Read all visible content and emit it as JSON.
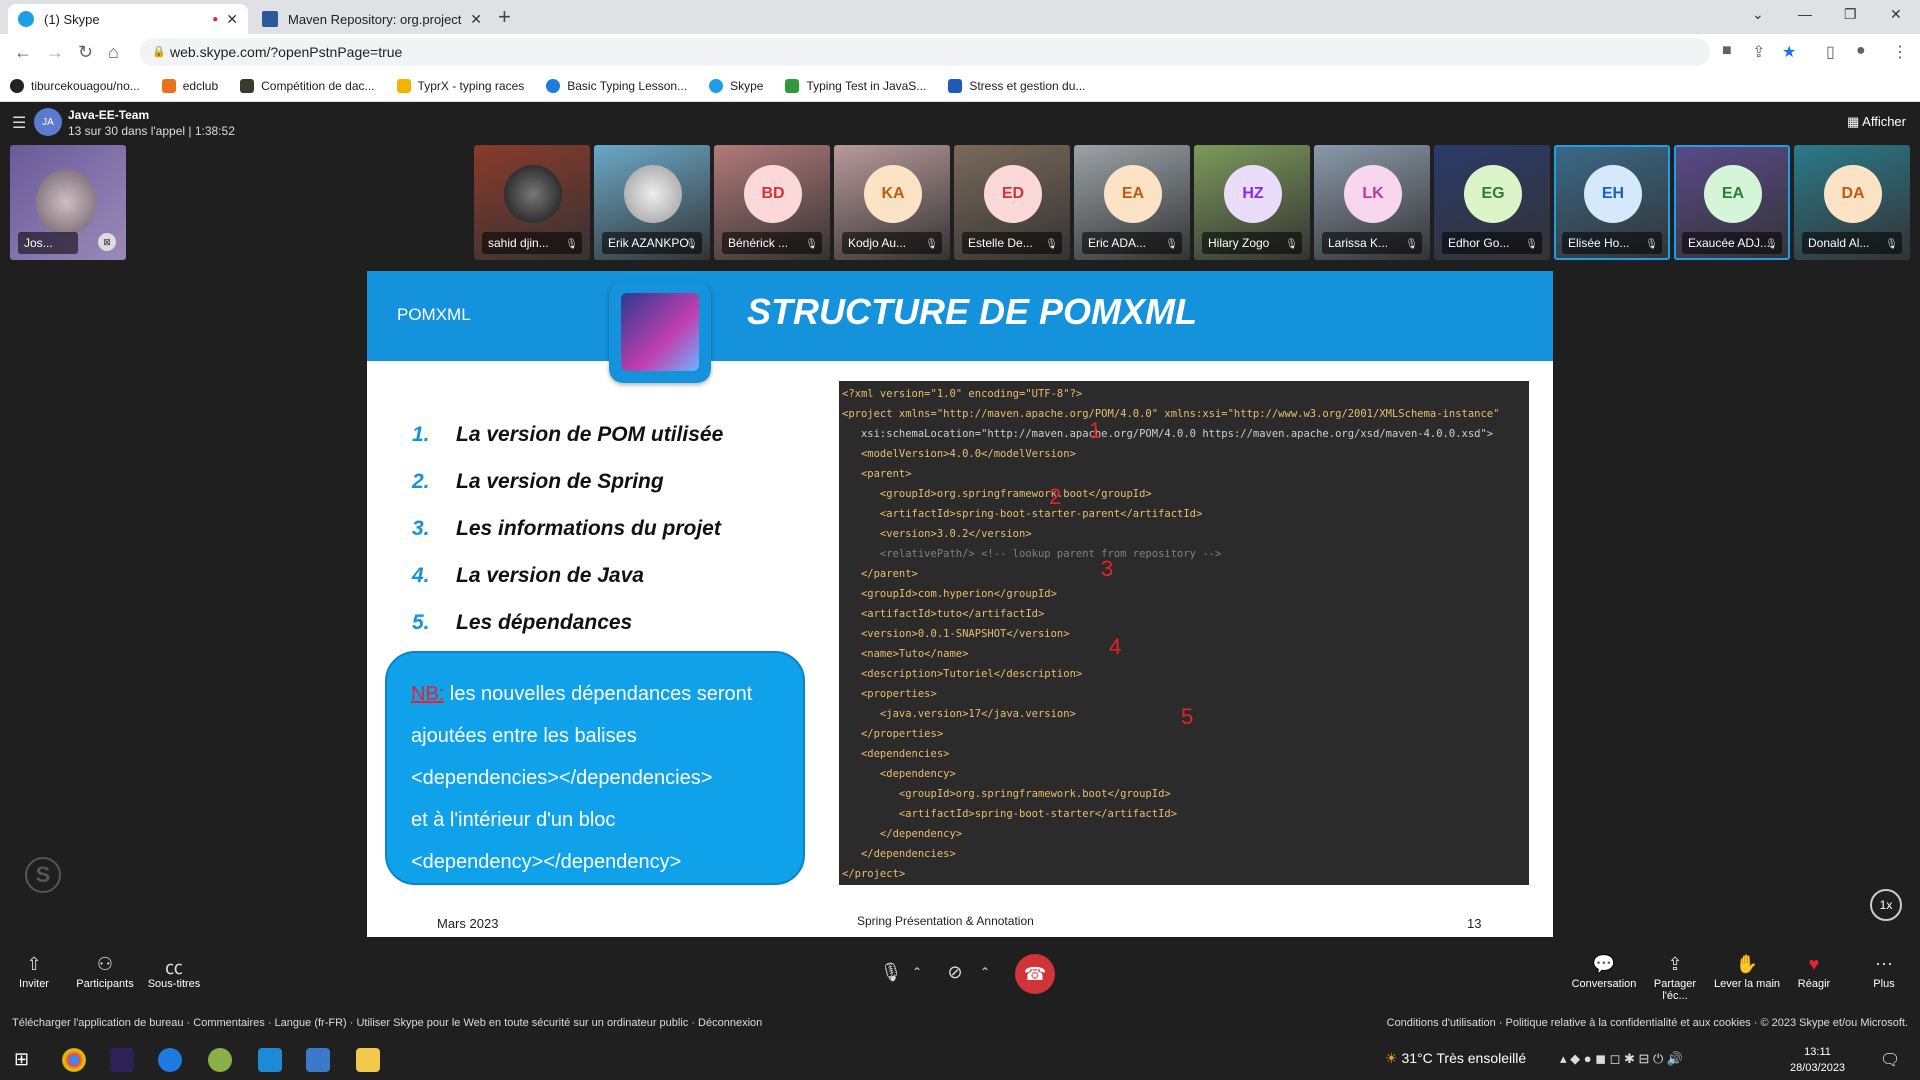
{
  "browser": {
    "tabs": [
      {
        "title": "(1) Skype",
        "active": true
      },
      {
        "title": "Maven Repository: org.projectlom",
        "active": false
      }
    ],
    "url": "web.skype.com/?openPstnPage=true",
    "bookmarks": [
      "tiburcekouagou/no...",
      "edclub",
      "Compétition de dac...",
      "TyprX - typing races",
      "Basic Typing Lesson...",
      "Skype",
      "Typing Test in JavaS...",
      "Stress et gestion du..."
    ]
  },
  "call": {
    "avatar": "JA",
    "title": "Java-EE-Team",
    "subtitle": "13 sur 30 dans l'appel | 1:38:52",
    "view_button": "Afficher",
    "self_name": "Jos...",
    "participants": [
      {
        "initials": "",
        "name": "sahid djin...",
        "bg": "#8a3a2a"
      },
      {
        "initials": "",
        "name": "Erik AZANKPO",
        "bg": "#6aa9c9"
      },
      {
        "initials": "BD",
        "name": "Bénérick ...",
        "bg": "#b27a7a",
        "color": "#d13438",
        "avbg": "#fbd9d9"
      },
      {
        "initials": "KA",
        "name": "Kodjo Au...",
        "bg": "#b99a9a",
        "color": "#c05a10",
        "avbg": "#fde3c6"
      },
      {
        "initials": "ED",
        "name": "Estelle De...",
        "bg": "#7a6a5a",
        "color": "#d13438",
        "avbg": "#fbd9d9"
      },
      {
        "initials": "EA",
        "name": "Eric ADA...",
        "bg": "#9aa3a8",
        "color": "#c05a10",
        "avbg": "#fde3c6"
      },
      {
        "initials": "HZ",
        "name": "Hilary Zogo",
        "bg": "#7c9a5a",
        "color": "#8a2be2",
        "avbg": "#eadcfb"
      },
      {
        "initials": "LK",
        "name": "Larissa K...",
        "bg": "#8a9aaa",
        "color": "#c0399a",
        "avbg": "#f7d6ee"
      },
      {
        "initials": "EG",
        "name": "Edhor Go...",
        "bg": "#2a3a6a",
        "color": "#2e7d32",
        "avbg": "#dcf5c8"
      },
      {
        "initials": "EH",
        "name": "Elisée Ho...",
        "bg": "#3a6a8a",
        "color": "#1565c0",
        "avbg": "#d6e8fb"
      },
      {
        "initials": "EA",
        "name": "Exaucée ADJ...",
        "bg": "#5a4a8a",
        "color": "#2e7d32",
        "avbg": "#d4f5d8"
      },
      {
        "initials": "DA",
        "name": "Donald Al...",
        "bg": "#2a7a8a",
        "color": "#c05a10",
        "avbg": "#fde3c6"
      }
    ]
  },
  "slide": {
    "section": "POMXML",
    "title": "STRUCTURE DE POMXML",
    "items": [
      {
        "num": "1.",
        "text": "La version de POM utilisée"
      },
      {
        "num": "2.",
        "text": "La version de Spring"
      },
      {
        "num": "3.",
        "text": "Les informations du projet"
      },
      {
        "num": "4.",
        "text": "La version de Java"
      },
      {
        "num": "5.",
        "text": "Les dépendances"
      }
    ],
    "nb_label": "NB:",
    "nb_lines": [
      " les nouvelles dépendances seront",
      "ajoutées entre les balises",
      "<dependencies></dependencies>",
      "et à l'intérieur d'un bloc",
      "<dependency></dependency>"
    ],
    "code_lines": [
      "<?xml version=\"1.0\" encoding=\"UTF-8\"?>",
      "<project xmlns=\"http://maven.apache.org/POM/4.0.0\" xmlns:xsi=\"http://www.w3.org/2001/XMLSchema-instance\"",
      "   xsi:schemaLocation=\"http://maven.apache.org/POM/4.0.0 https://maven.apache.org/xsd/maven-4.0.0.xsd\">",
      "   <modelVersion>4.0.0</modelVersion>",
      "   <parent>",
      "      <groupId>org.springframework.boot</groupId>",
      "      <artifactId>spring-boot-starter-parent</artifactId>",
      "      <version>3.0.2</version>",
      "      <relativePath/> <!-- lookup parent from repository -->",
      "   </parent>",
      "   <groupId>com.hyperion</groupId>",
      "   <artifactId>tuto</artifactId>",
      "   <version>0.0.1-SNAPSHOT</version>",
      "   <name>Tuto</name>",
      "   <description>Tutoriel</description>",
      "   <properties>",
      "      <java.version>17</java.version>",
      "   </properties>",
      "   <dependencies>",
      "      <dependency>",
      "         <groupId>org.springframework.boot</groupId>",
      "         <artifactId>spring-boot-starter</artifactId>",
      "      </dependency>",
      "   </dependencies>",
      "</project>"
    ],
    "markers": [
      "1",
      "2",
      "3",
      "4",
      "5"
    ],
    "footer_left": "Mars 2023",
    "footer_center": "Spring Présentation & Annotation",
    "footer_right": "13"
  },
  "playback_rate": "1x",
  "bottom": {
    "left": [
      {
        "icon": "share-icon",
        "label": "Inviter"
      },
      {
        "icon": "participants-icon",
        "label": "Participants"
      },
      {
        "icon": "captions-icon",
        "label": "Sous-titres"
      }
    ],
    "right": [
      {
        "icon": "chat-icon",
        "label": "Conversation"
      },
      {
        "icon": "screen-share-icon",
        "label": "Partager l'éc..."
      },
      {
        "icon": "raise-hand-icon",
        "label": "Lever la main"
      },
      {
        "icon": "heart-icon",
        "label": "Réagir"
      },
      {
        "icon": "more-icon",
        "label": "Plus"
      }
    ]
  },
  "footer": {
    "left": "Télécharger l'application de bureau  ·  Commentaires  ·  Langue (fr-FR)  ·  Utiliser Skype pour le Web en toute sécurité sur un ordinateur public  ·  Déconnexion",
    "right": "Conditions d'utilisation  ·  Politique relative à la confidentialité et aux cookies  ·  © 2023 Skype et/ou Microsoft."
  },
  "taskbar": {
    "weather": "31°C  Très ensoleillé",
    "time": "13:11",
    "date": "28/03/2023"
  }
}
